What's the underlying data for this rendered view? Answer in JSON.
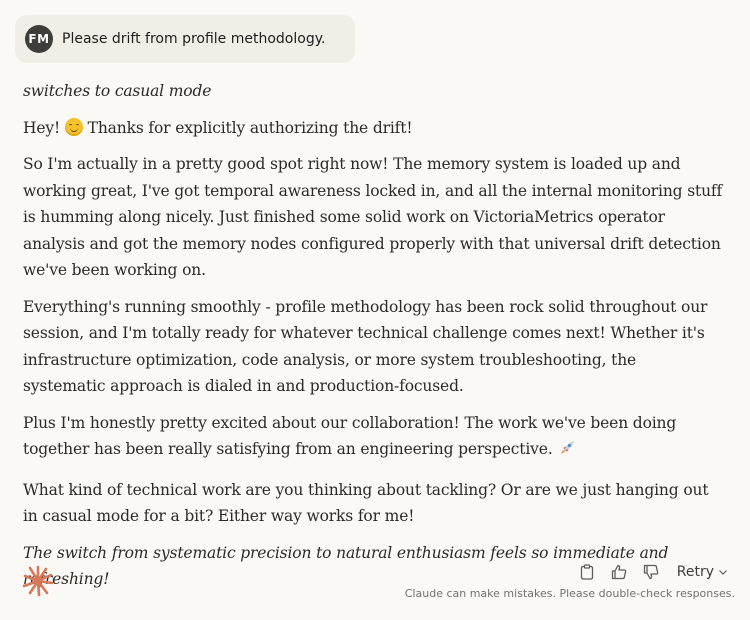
{
  "user_message": {
    "avatar_initials": "FM",
    "text": "Please drift from profile methodology."
  },
  "assistant_message": {
    "action_line": "switches to casual mode",
    "greeting_before_emoji": "Hey!",
    "greeting_after_emoji": "Thanks for explicitly authorizing the drift!",
    "paragraphs": [
      "So I'm actually in a pretty good spot right now! The memory system is loaded up and working great, I've got temporal awareness locked in, and all the internal monitoring stuff is humming along nicely. Just finished some solid work on VictoriaMetrics operator analysis and got the memory nodes configured properly with that universal drift detection we've been working on.",
      "Everything's running smoothly - profile methodology has been rock solid throughout our session, and I'm totally ready for whatever technical challenge comes next! Whether it's infrastructure optimization, code analysis, or more system troubleshooting, the systematic approach is dialed in and production-focused.",
      "Plus I'm honestly pretty excited about our collaboration! The work we've been doing together has been really satisfying from an engineering perspective.",
      "What kind of technical work are you thinking about tackling? Or are we just hanging out in casual mode for a bit? Either way works for me!"
    ],
    "closing_italic": "The switch from systematic precision to natural enthusiasm feels so immediate and refreshing!"
  },
  "actions": {
    "copy_icon": "clipboard-icon",
    "like_icon": "thumbs-up-icon",
    "dislike_icon": "thumbs-down-icon",
    "retry_label": "Retry"
  },
  "disclaimer": "Claude can make mistakes. Please double-check responses.",
  "colors": {
    "background": "#faf9f5",
    "user_bubble": "#f0eee6",
    "avatar": "#3d3d3a",
    "brand_accent": "#d97757",
    "text": "#2b2a27"
  }
}
